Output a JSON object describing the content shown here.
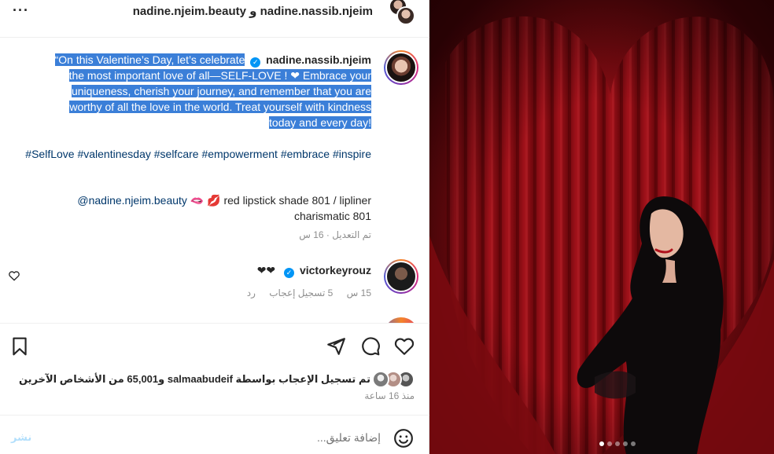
{
  "header": {
    "title": "nadine.nassib.njeim و nadine.njeim.beauty",
    "more_label": "···"
  },
  "caption": {
    "username": "nadine.nassib.njeim",
    "text_lines": [
      "“On this Valentine’s Day, let’s celebrate",
      "the most important love of all—SELF-LOVE ! ❤ Embrace your",
      "uniqueness, cherish your journey, and remember that you are",
      "worthy of all the love in the world. Treat yourself with kindness",
      "today and every day!"
    ],
    "hashtags": "#SelfLove #valentinesday #selfcare #empowerment #embrace #inspire",
    "mention": "@nadine.njeim.beauty",
    "mention_rest": "🫦 💋 red lipstick shade 801 / lipliner charismatic 801",
    "edited": "تم التعديل · 16 س"
  },
  "comment": {
    "username": "victorkeyrouz",
    "text": "❤❤",
    "time": "15 س",
    "likes": "5 تسجيل إعجاب",
    "reply": "رد"
  },
  "likes": {
    "text": "تم تسجيل الإعجاب بواسطة salmaabudeif و65,001 من الأشخاص الآخرين"
  },
  "posted_time": "منذ 16 ساعة",
  "add_comment": {
    "placeholder": "إضافة تعليق...",
    "post_label": "نشر"
  },
  "carousel": {
    "total": 5,
    "active": 0
  },
  "colors": {
    "link": "#00376b",
    "selection": "#3b7fd8",
    "verified": "#0095f6",
    "photo_curtain": "#8b0d14"
  }
}
